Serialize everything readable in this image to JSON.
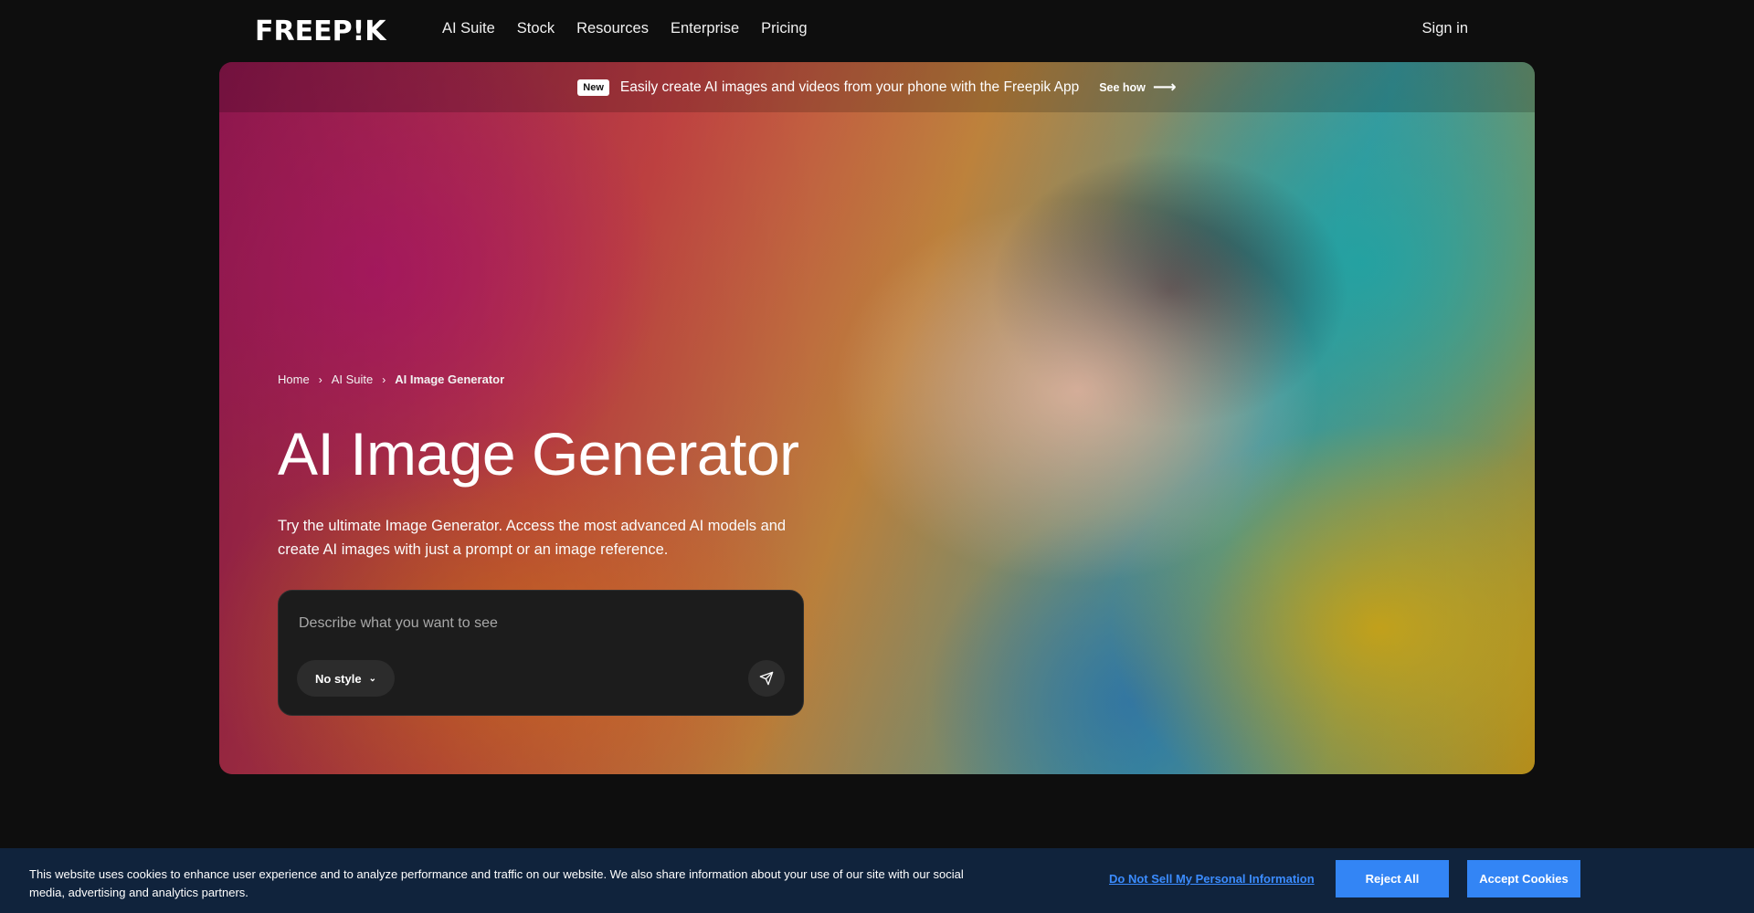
{
  "header": {
    "logo": "FREEP!K",
    "nav": [
      "AI Suite",
      "Stock",
      "Resources",
      "Enterprise",
      "Pricing"
    ],
    "sign_in": "Sign in"
  },
  "announcement": {
    "badge": "New",
    "text": "Easily create AI images and videos from your phone with the Freepik App",
    "cta": "See how"
  },
  "breadcrumb": {
    "items": [
      "Home",
      "AI Suite"
    ],
    "current": "AI Image Generator"
  },
  "hero": {
    "title": "AI Image Generator",
    "subtitle": "Try the ultimate Image Generator. Access the most advanced AI models and create AI images with just a prompt or an image reference."
  },
  "prompt": {
    "placeholder": "Describe what you want to see",
    "style_label": "No style"
  },
  "cookie": {
    "text": "This website uses cookies to enhance user experience and to analyze performance and traffic on our website. We also share information about your use of our site with our social media, advertising and analytics partners.",
    "dns_link": "Do Not Sell My Personal Information",
    "reject": "Reject All",
    "accept": "Accept Cookies"
  },
  "icons": {
    "arrow": "arrow-right-icon",
    "chevron": "chevron-right-icon",
    "caret": "chevron-down-icon",
    "send": "send-icon"
  }
}
